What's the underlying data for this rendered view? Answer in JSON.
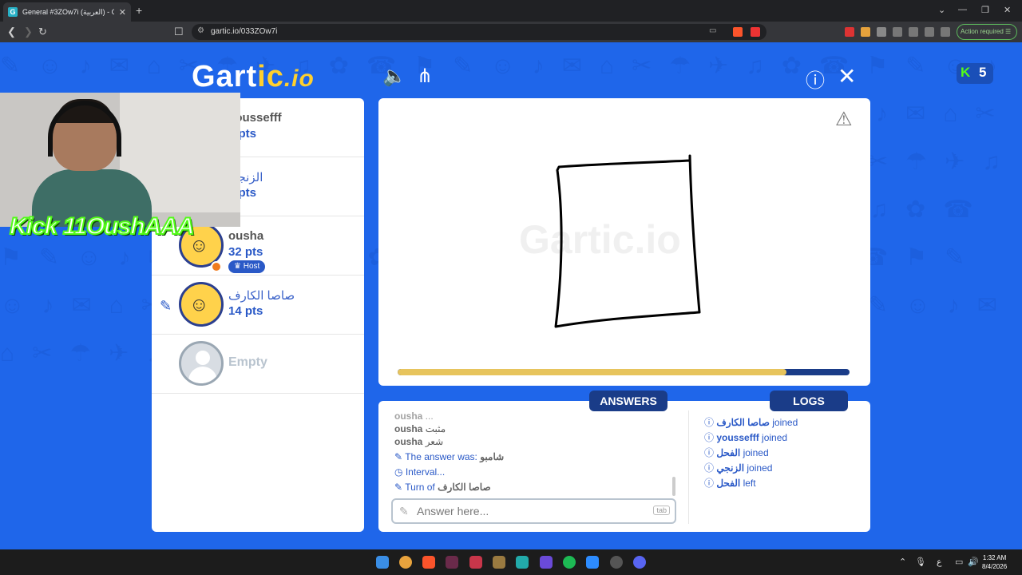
{
  "browser": {
    "tab_title": "General #3ZOw7i (العربية) - Gartic",
    "url": "gartic.io/033ZOw7i",
    "action_required": "Action required"
  },
  "header": {
    "logo": {
      "prefix": "Gart",
      "mid": "ic",
      "suffix": ".io"
    },
    "kick_count": "5"
  },
  "players": [
    {
      "name": "youssefff",
      "pts": "5 pts",
      "host": false
    },
    {
      "name": "الزنجي",
      "pts": "5 pts",
      "host": false
    },
    {
      "name": "ousha",
      "pts": "32 pts",
      "host": true,
      "host_label": "Host"
    },
    {
      "name": "صاصا الكارف",
      "pts": "14 pts",
      "drawing": true
    },
    {
      "name": "Empty",
      "empty": true
    }
  ],
  "overlay": {
    "streamer_tag": "Kick 11OushAAA"
  },
  "canvas": {
    "watermark": "Gartic.io",
    "timer_fraction": 0.86,
    "stroke_color": "#000000"
  },
  "chat": {
    "answers_tab": "ANSWERS",
    "logs_tab": "LOGS",
    "answers": [
      {
        "user": "ousha",
        "text": "مثبت"
      },
      {
        "user": "ousha",
        "text": "شعر"
      }
    ],
    "answer_was_label": "The answer was:",
    "answer_was_value": "شامبو",
    "interval_label": "Interval...",
    "turn_label": "Turn of",
    "turn_value": "صاصا الكارف",
    "input_placeholder": "Answer here...",
    "tab_key": "tab"
  },
  "logs": [
    {
      "name": "صاصا الكارف",
      "action": "joined"
    },
    {
      "name": "youssefff",
      "action": "joined"
    },
    {
      "name": "الفحل",
      "action": "joined"
    },
    {
      "name": "الزنجي",
      "action": "joined"
    },
    {
      "name": "الفحل",
      "action": "left"
    }
  ],
  "taskbar": {
    "time": "1:32 AM",
    "date": "8/4/2026",
    "lang": "ع"
  }
}
